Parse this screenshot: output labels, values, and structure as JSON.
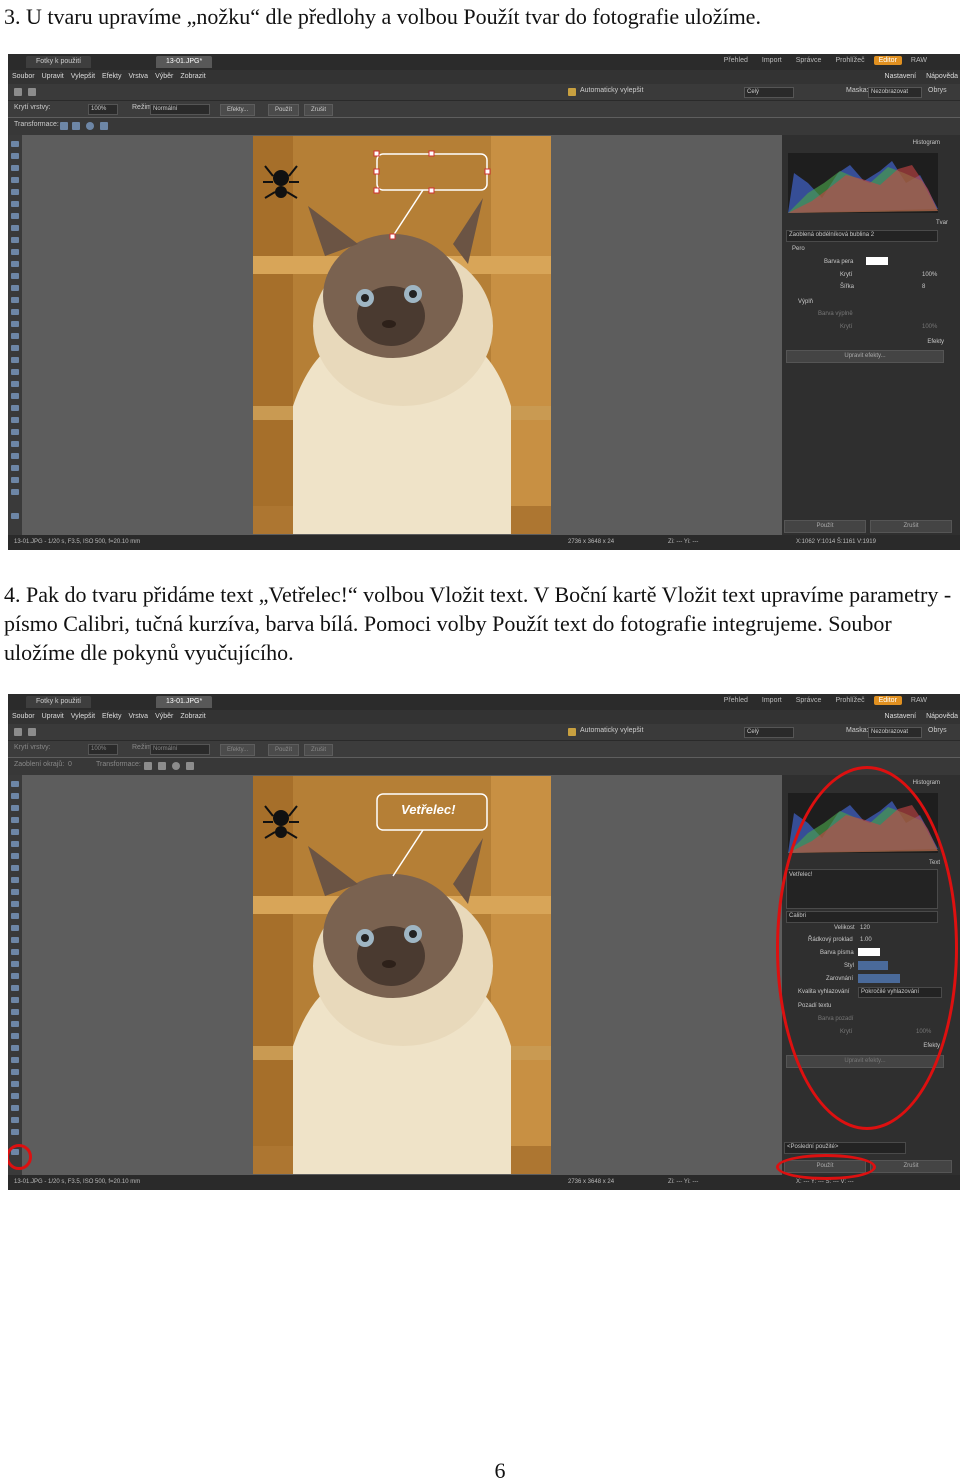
{
  "step3": "3. U tvaru upravíme „nožku“ dle předlohy a volbou Použít tvar do fotografie uložíme.",
  "step4": "4. Pak do tvaru přidáme text „Vetřelec!“ volbou Vložit text. V Boční kartě Vložit text upravíme parametry - písmo Calibri, tučná kurzíva, barva bílá. Pomoci volby Použít text do fotografie integrujeme. Soubor uložíme dle pokynů vyučujícího.",
  "page_number": "6",
  "app": {
    "tab_docs": "Fotky k použití",
    "tab_image": "13-01.JPG*",
    "modes": [
      "Přehled",
      "Import",
      "Správce",
      "Prohlížeč",
      "Editor",
      "RAW"
    ],
    "menu": [
      "Soubor",
      "Upravit",
      "Vylepšit",
      "Efekty",
      "Vrstva",
      "Výběr",
      "Zobrazit"
    ],
    "settings": "Nastavení",
    "help": "Nápověda",
    "auto_enhance": "Automaticky vylepšit",
    "view_combo": "Celý",
    "mask_label": "Maska:",
    "mask_value": "Nezobrazovat",
    "overview": "Obrys",
    "opacity_label": "Krytí vrstvy:",
    "opacity_value": "100%",
    "mode_label": "Režim:",
    "mode_value": "Normální",
    "effects_btn": "Efekty...",
    "apply_btn": "Použít",
    "cancel_btn": "Zrušit",
    "transform_label": "Transformace:",
    "rounded_rect_label": "Zaoblení okrajů:",
    "rounded_rect_value": "0",
    "status_file": "13-01.JPG - 1/20 s, F3.5, ISO 500, f=20.10 mm",
    "status_size": "2736 x 3648 x 24",
    "status_zoom": "Zi: ---   Yi: ---",
    "status_coords1": "X:1062  Y:1014  Š:1161  V:1919",
    "status_coords2": "X: ---  Y: ---  Š: ---  V: ---",
    "bubble_text": "Vetřelec!"
  },
  "panel1": {
    "histogram": "Histogram",
    "section": "Tvar",
    "shape_combo": "Zaoblená obdélníková bublina 2",
    "pen": "Pero",
    "pen_color": "Barva pera",
    "opacity": "Krytí",
    "opacity_value": "100%",
    "width": "Šířka",
    "width_value": "8",
    "fill": "Výplň",
    "fill_color": "Barva výplně",
    "fill_opacity": "Krytí",
    "fill_opacity_value": "100%",
    "effects": "Efekty",
    "edit_effects": "Upravit efekty...",
    "apply": "Použít",
    "cancel": "Zrušit"
  },
  "panel2": {
    "histogram": "Histogram",
    "section": "Text",
    "text_value": "Vetřelec!",
    "font": "Calibri",
    "size_label": "Velikost",
    "size_value": "120",
    "line_label": "Řádkový proklad",
    "line_value": "1.00",
    "color_label": "Barva písma",
    "style_label": "Styl",
    "align_label": "Zarovnání",
    "quality_label": "Kvalita vyhlazování",
    "quality_value": "Pokročilé vyhlazování",
    "bg_label": "Pozadí textu",
    "bg_color": "Barva pozadí",
    "bg_opacity": "Krytí",
    "bg_opacity_value": "100%",
    "effects": "Efekty",
    "edit_effects": "Upravit efekty...",
    "last_used": "<Poslední použité>",
    "apply": "Použít",
    "cancel": "Zrušit"
  }
}
